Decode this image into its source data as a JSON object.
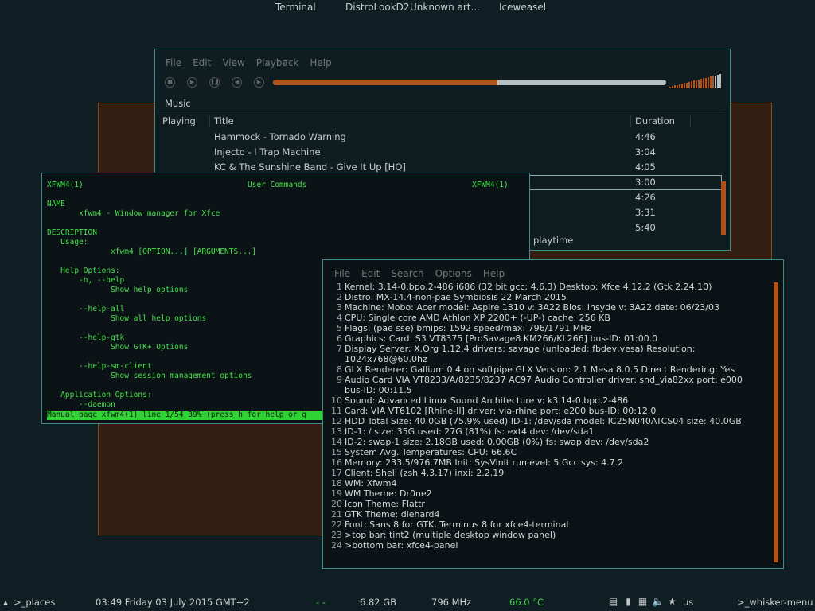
{
  "topbar": {
    "tasks": [
      "Terminal",
      "DistroLookD2",
      "Unknown art...",
      "Iceweasel"
    ]
  },
  "player": {
    "menu": [
      "File",
      "Edit",
      "View",
      "Playback",
      "Help"
    ],
    "controls": [
      "stop-icon",
      "play-icon",
      "pause-icon",
      "previous-icon",
      "next-icon"
    ],
    "progress": 0.57,
    "playlist_tab": "Music",
    "columns": {
      "playing": "Playing",
      "title": "Title",
      "duration": "Duration"
    },
    "tracks": [
      {
        "title": "Hammock - Tornado Warning",
        "duration": "4:46"
      },
      {
        "title": "Injecto - I Trap Machine",
        "duration": "3:04"
      },
      {
        "title": "KC & The Sunshine Band - Give It Up [HQ]",
        "duration": "4:05"
      },
      {
        "title": "",
        "duration": "3:00"
      },
      {
        "title": "",
        "duration": "4:26"
      },
      {
        "title": "",
        "duration": "3:31"
      },
      {
        "title": "",
        "duration": "5:40"
      }
    ],
    "footer": "playtime",
    "accent": "#b2521b"
  },
  "manpage": {
    "header_left": "XFWM4(1)",
    "header_center": "User Commands",
    "header_right": "XFWM4(1)",
    "lines": [
      "NAME",
      "       xfwm4 - Window manager for Xfce",
      "",
      "DESCRIPTION",
      "   Usage:",
      "              xfwm4 [OPTION...] [ARGUMENTS...]",
      "",
      "   Help Options:",
      "       -h, --help",
      "              Show help options",
      "",
      "       --help-all",
      "              Show all help options",
      "",
      "       --help-gtk",
      "              Show GTK+ Options",
      "",
      "       --help-sm-client",
      "              Show session management options",
      "",
      "   Application Options:",
      "       --daemon"
    ],
    "status": "Manual page xfwm4(1) line 1/54 39% (press h for help or q",
    "text_color": "#47e14c"
  },
  "inxi": {
    "menu": [
      "File",
      "Edit",
      "Search",
      "Options",
      "Help"
    ],
    "lines": [
      {
        "n": "1",
        "t": "Kernel: 3.14-0.bpo.2-486 i686 (32 bit gcc: 4.6.3) Desktop: Xfce 4.12.2 (Gtk 2.24.10)"
      },
      {
        "n": "2",
        "t": "Distro: MX-14.4-non-pae Symbiosis 22 March 2015"
      },
      {
        "n": "3",
        "t": "Machine: Mobo: Acer model: Aspire 1310 v: 3A22 Bios: Insyde v: 3A22 date: 06/23/03"
      },
      {
        "n": "4",
        "t": "CPU: Single core AMD Athlon XP 2200+ (-UP-) cache: 256 KB"
      },
      {
        "n": "5",
        "t": "Flags: (pae sse) bmips: 1592 speed/max: 796/1791 MHz"
      },
      {
        "n": "6",
        "t": "Graphics:  Card: S3 VT8375 [ProSavage8 KM266/KL266] bus-ID: 01:00.0"
      },
      {
        "n": "7",
        "t": "Display Server: X.Org 1.12.4 drivers: savage (unloaded: fbdev,vesa) Resolution:"
      },
      {
        "n": "",
        "t": "1024x768@60.0hz"
      },
      {
        "n": "8",
        "t": "GLX Renderer: Gallium 0.4 on softpipe GLX Version: 2.1 Mesa 8.0.5 Direct Rendering: Yes"
      },
      {
        "n": "9",
        "t": "Audio Card VIA VT8233/A/8235/8237 AC97 Audio Controller driver: snd_via82xx port: e000"
      },
      {
        "n": "",
        "t": "bus-ID: 00:11.5"
      },
      {
        "n": "10",
        "t": "Sound: Advanced Linux Sound Architecture v: k3.14-0.bpo.2-486"
      },
      {
        "n": "11",
        "t": "Card: VIA VT6102 [Rhine-II] driver: via-rhine port: e200 bus-ID: 00:12.0"
      },
      {
        "n": "12",
        "t": "HDD Total Size: 40.0GB (75.9% used) ID-1: /dev/sda model: IC25N040ATCS04 size: 40.0GB"
      },
      {
        "n": "13",
        "t": "ID-1: / size: 35G used: 27G (81%) fs: ext4 dev: /dev/sda1"
      },
      {
        "n": "14",
        "t": "ID-2: swap-1 size: 2.18GB used: 0.00GB (0%) fs: swap dev: /dev/sda2"
      },
      {
        "n": "15",
        "t": "System Avg. Temperatures: CPU: 66.6C"
      },
      {
        "n": "16",
        "t": "Memory: 233.5/976.7MB Init: SysVinit runlevel: 5 Gcc sys: 4.7.2"
      },
      {
        "n": "17",
        "t": "Client: Shell (zsh 4.3.17) inxi: 2.2.19"
      },
      {
        "n": "18",
        "t": "WM: Xfwm4"
      },
      {
        "n": "19",
        "t": "WM Theme: Dr0ne2"
      },
      {
        "n": "20",
        "t": "Icon Theme: Flattr"
      },
      {
        "n": "21",
        "t": "GTK Theme: diehard4"
      },
      {
        "n": "22",
        "t": "Font: Sans 8 for GTK, Terminus 8 for xfce4-terminal"
      },
      {
        "n": "23",
        "t": ">top bar: tint2 (multiple desktop window panel)"
      },
      {
        "n": "24",
        "t": ">bottom bar: xfce4-panel"
      }
    ]
  },
  "panel": {
    "places": ">_places",
    "clock": "03:49 Friday 03 July 2015 GMT+2",
    "dashes": "- -",
    "disk": "6.82 GB",
    "cpu_freq": "796 MHz",
    "temp": "66.0 °C",
    "temp_color": "#3fd24a",
    "keyboard": "us",
    "menu": ">_whisker-menu"
  }
}
